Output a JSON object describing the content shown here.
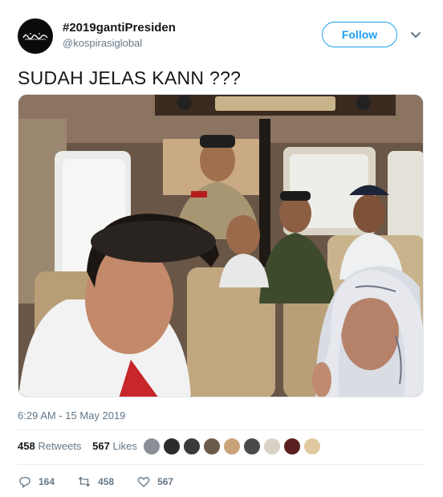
{
  "tweet": {
    "display_name": "#2019gantiPresiden",
    "handle": "@kospirasiglobal",
    "follow_label": "Follow",
    "text": "SUDAH JELAS KANN ???",
    "timestamp": "6:29 AM - 15 May 2019"
  },
  "stats": {
    "retweets_count": "458",
    "retweets_label": "Retweets",
    "likes_count": "567",
    "likes_label": "Likes",
    "liker_avatar_colors": [
      "#8a8f96",
      "#2b2b2b",
      "#3a3a3a",
      "#6b5b4b",
      "#c9a27a",
      "#4a4a4a",
      "#d8d2c4",
      "#5a1f1f",
      "#e0c9a0"
    ]
  },
  "actions": {
    "reply_count": "164",
    "retweet_count": "458",
    "like_count": "567"
  },
  "colors": {
    "accent": "#1da1f2",
    "secondary_text": "#657786",
    "primary_text": "#14171a"
  },
  "icons": {
    "reply": "reply-icon",
    "retweet": "retweet-icon",
    "like": "heart-icon",
    "more": "chevron-down-icon"
  }
}
